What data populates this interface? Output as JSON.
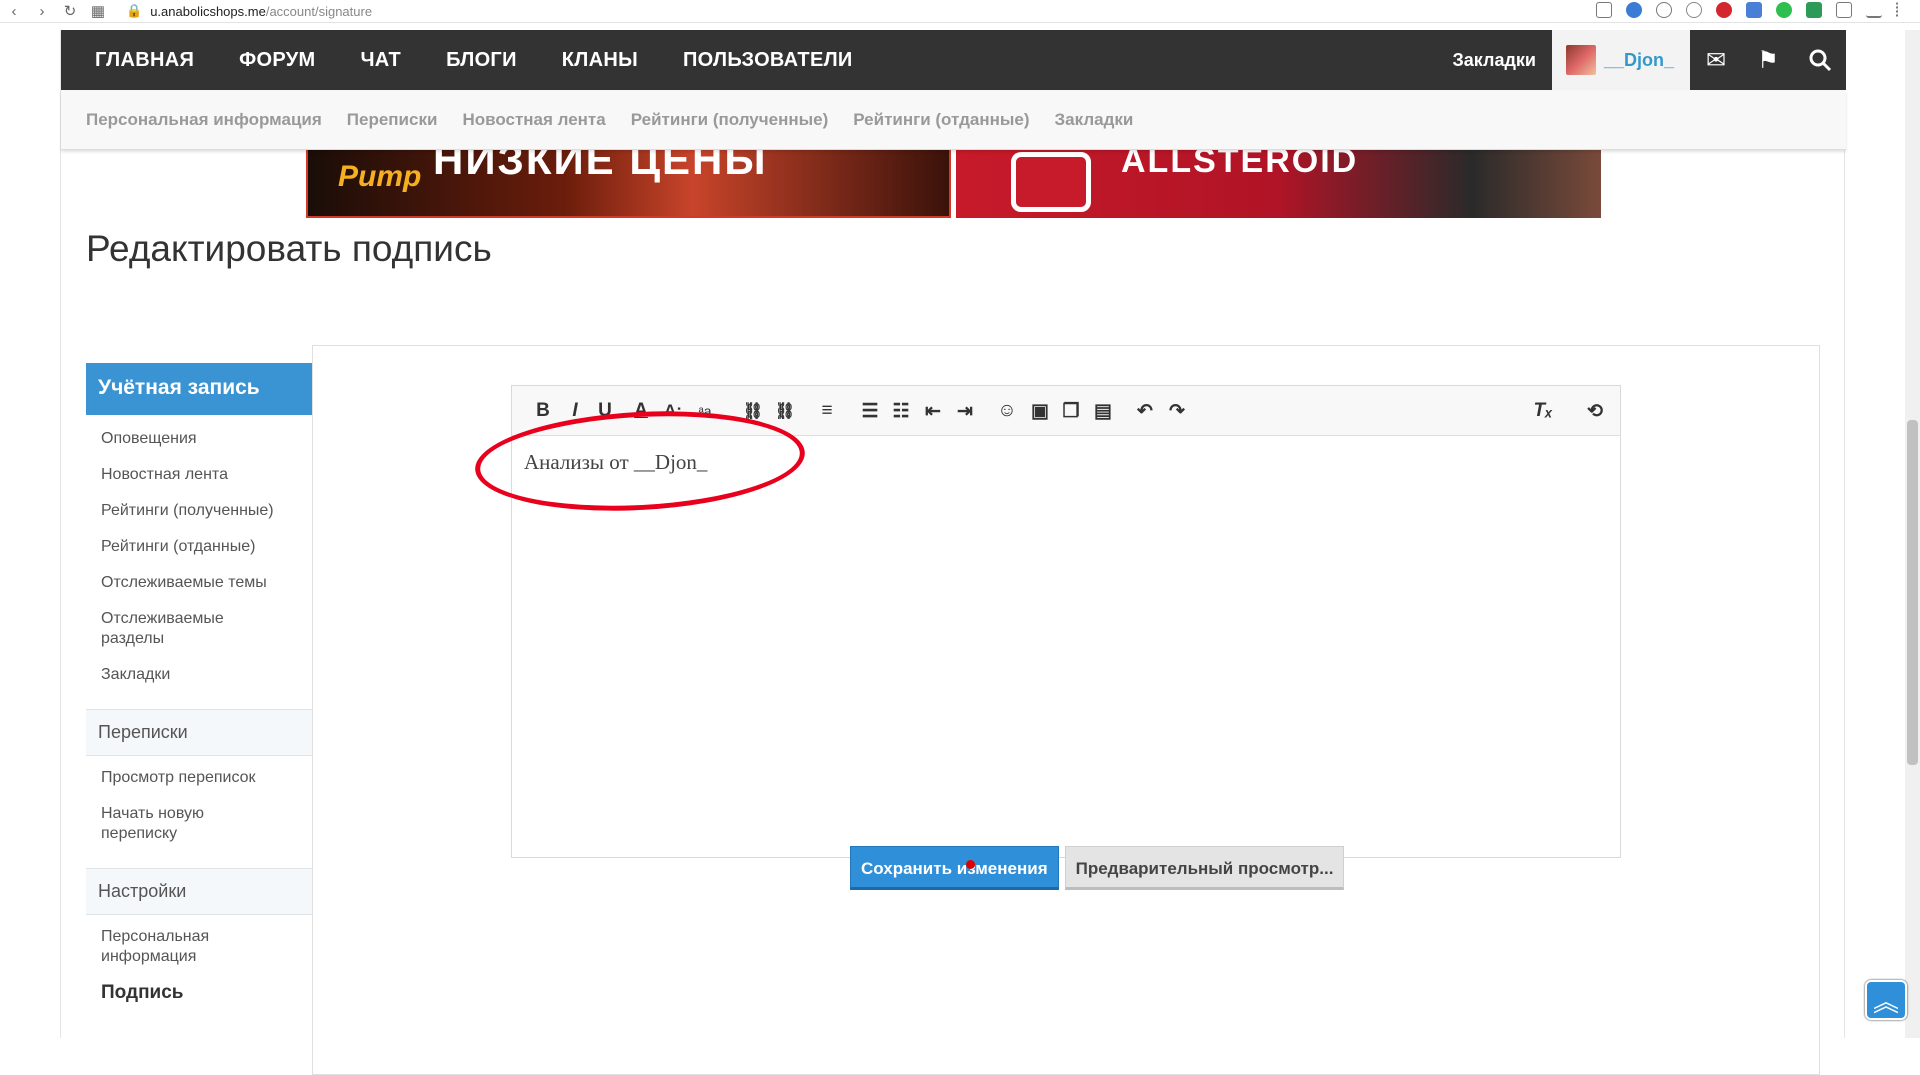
{
  "browser": {
    "url_host": "u.anabolicshops.me",
    "url_path": "/account/signature"
  },
  "topnav": {
    "items": [
      "ГЛАВНАЯ",
      "ФОРУМ",
      "ЧАТ",
      "БЛОГИ",
      "КЛАНЫ",
      "ПОЛЬЗОВАТЕЛИ"
    ],
    "bookmarks": "Закладки",
    "username": "__Djon_"
  },
  "subnav": {
    "items": [
      "Персональная информация",
      "Переписки",
      "Новостная лента",
      "Рейтинги (полученные)",
      "Рейтинги (отданные)",
      "Закладки"
    ]
  },
  "banners": {
    "left_text": "НИЗКИЕ ЦЕНЫ",
    "left_logo": "Pump",
    "right_text": "ALLSTEROID"
  },
  "page": {
    "title": "Редактировать подпись"
  },
  "sidebar": {
    "account_header": "Учётная запись",
    "account_items": [
      "Оповещения",
      "Новостная лента",
      "Рейтинги (полученные)",
      "Рейтинги (отданные)",
      "Отслеживаемые темы",
      "Отслеживаемые разделы",
      "Закладки"
    ],
    "conversations_header": "Переписки",
    "conversations_items": [
      "Просмотр переписок",
      "Начать новую переписку"
    ],
    "settings_header": "Настройки",
    "settings_items": [
      "Персональная информация",
      "Подпись"
    ]
  },
  "editor": {
    "content": "Анализы от __Djon_"
  },
  "actions": {
    "save": "Сохранить изменения",
    "preview": "Предварительный просмотр..."
  }
}
